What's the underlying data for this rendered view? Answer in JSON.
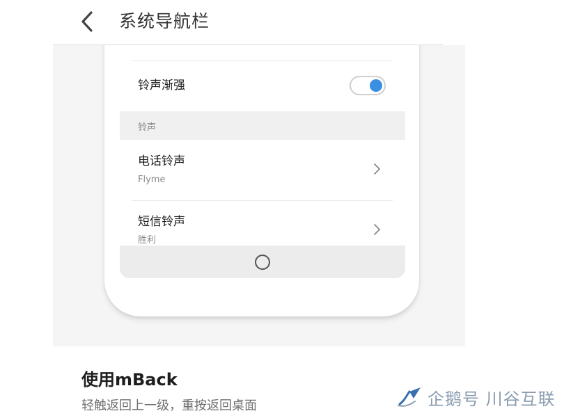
{
  "header": {
    "title": "系统导航栏"
  },
  "preview": {
    "rows": {
      "fade_in": {
        "label": "铃声渐强",
        "toggle_on": true
      },
      "section_label": "铃声",
      "phone_ringtone": {
        "label": "电话铃声",
        "value": "Flyme"
      },
      "sms_ringtone": {
        "label": "短信铃声",
        "value": "胜利"
      }
    }
  },
  "option": {
    "title": "使用mBack",
    "description": "轻触返回上一级，重按返回桌面"
  },
  "watermark": {
    "text": "企鹅号 川谷互联"
  },
  "colors": {
    "toggle_accent": "#3a8fe0",
    "section_bg": "#f0f0f0",
    "navbar_bg": "#ececec",
    "watermark": "#8a9bb0"
  },
  "icons": {
    "back": "chevron-left-icon",
    "row_arrow": "chevron-right-icon",
    "home": "home-circle-icon",
    "watermark_logo": "penguin-logo-icon"
  }
}
